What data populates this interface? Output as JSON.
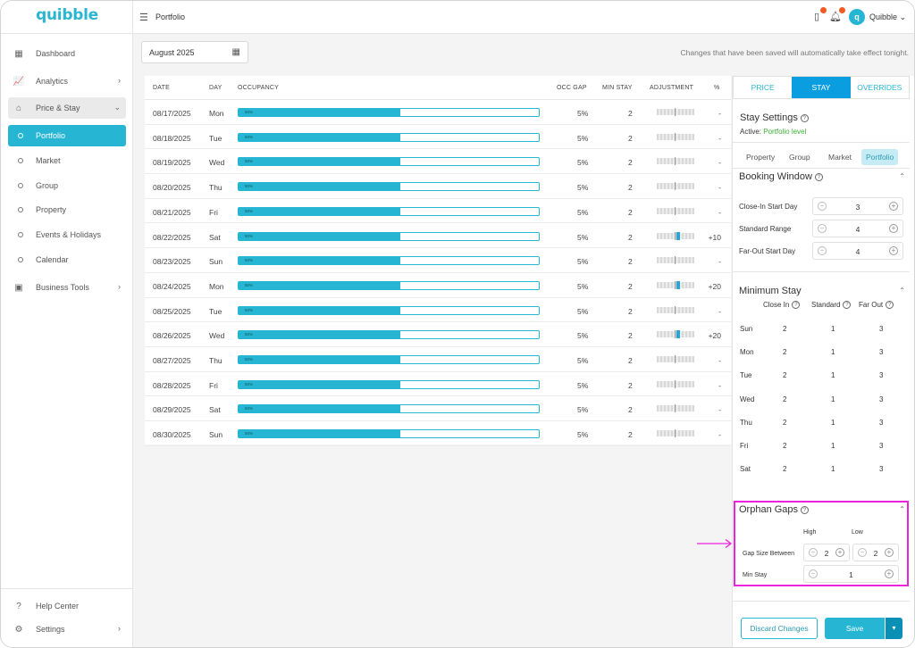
{
  "app": {
    "logo": "quibble"
  },
  "sidebar": {
    "items": [
      {
        "label": "Dashboard",
        "icon": "grid-icon"
      },
      {
        "label": "Analytics",
        "icon": "chart-icon"
      },
      {
        "label": "Price & Stay",
        "icon": "house-dollar-icon"
      },
      {
        "label": "Portfolio"
      },
      {
        "label": "Market"
      },
      {
        "label": "Group"
      },
      {
        "label": "Property"
      },
      {
        "label": "Events & Holidays"
      },
      {
        "label": "Calendar"
      },
      {
        "label": "Business Tools",
        "icon": "briefcase-icon"
      }
    ],
    "help_center": "Help Center",
    "settings": "Settings"
  },
  "topbar": {
    "breadcrumb": "Portfolio",
    "user_name": "Quibble",
    "avatar_letter": "q"
  },
  "toolbar": {
    "month": "August 2025",
    "notice": "Changes that have been saved will automatically take effect tonight."
  },
  "table": {
    "headers": {
      "date": "DATE",
      "day": "DAY",
      "occupancy": "OCCUPANCY",
      "occ_gap": "OCC GAP",
      "min_stay": "MIN STAY",
      "adjustment": "ADJUSTMENT",
      "pct": "%"
    },
    "rows": [
      {
        "date": "08/17/2025",
        "day": "Mon",
        "occ": 0.54,
        "occ_label": "50%",
        "gap": "5%",
        "min": "2",
        "adj": 0,
        "pct": "-"
      },
      {
        "date": "08/18/2025",
        "day": "Tue",
        "occ": 0.54,
        "occ_label": "50%",
        "gap": "5%",
        "min": "2",
        "adj": 0,
        "pct": "-"
      },
      {
        "date": "08/19/2025",
        "day": "Wed",
        "occ": 0.54,
        "occ_label": "50%",
        "gap": "5%",
        "min": "2",
        "adj": 0,
        "pct": "-"
      },
      {
        "date": "08/20/2025",
        "day": "Thu",
        "occ": 0.54,
        "occ_label": "50%",
        "gap": "5%",
        "min": "2",
        "adj": 0,
        "pct": "-"
      },
      {
        "date": "08/21/2025",
        "day": "Fri",
        "occ": 0.54,
        "occ_label": "50%",
        "gap": "5%",
        "min": "2",
        "adj": 0,
        "pct": "-"
      },
      {
        "date": "08/22/2025",
        "day": "Sat",
        "occ": 0.54,
        "occ_label": "50%",
        "gap": "5%",
        "min": "2",
        "adj": 10,
        "pct": "+10"
      },
      {
        "date": "08/23/2025",
        "day": "Sun",
        "occ": 0.54,
        "occ_label": "50%",
        "gap": "5%",
        "min": "2",
        "adj": 0,
        "pct": "-"
      },
      {
        "date": "08/24/2025",
        "day": "Mon",
        "occ": 0.54,
        "occ_label": "50%",
        "gap": "5%",
        "min": "2",
        "adj": 20,
        "pct": "+20"
      },
      {
        "date": "08/25/2025",
        "day": "Tue",
        "occ": 0.54,
        "occ_label": "50%",
        "gap": "5%",
        "min": "2",
        "adj": 0,
        "pct": "-"
      },
      {
        "date": "08/26/2025",
        "day": "Wed",
        "occ": 0.54,
        "occ_label": "50%",
        "gap": "5%",
        "min": "2",
        "adj": 20,
        "pct": "+20"
      },
      {
        "date": "08/27/2025",
        "day": "Thu",
        "occ": 0.54,
        "occ_label": "50%",
        "gap": "5%",
        "min": "2",
        "adj": 0,
        "pct": "-"
      },
      {
        "date": "08/28/2025",
        "day": "Fri",
        "occ": 0.54,
        "occ_label": "50%",
        "gap": "5%",
        "min": "2",
        "adj": 0,
        "pct": "-"
      },
      {
        "date": "08/29/2025",
        "day": "Sat",
        "occ": 0.54,
        "occ_label": "50%",
        "gap": "5%",
        "min": "2",
        "adj": 0,
        "pct": "-"
      },
      {
        "date": "08/30/2025",
        "day": "Sun",
        "occ": 0.54,
        "occ_label": "50%",
        "gap": "5%",
        "min": "2",
        "adj": 0,
        "pct": "-"
      }
    ]
  },
  "panel": {
    "tabs": [
      "PRICE",
      "STAY",
      "OVERRIDES"
    ],
    "title": "Stay Settings",
    "active_label": "Active:",
    "active_value": "Portfolio level",
    "levels": [
      "Property",
      "Group",
      "Market",
      "Portfolio"
    ],
    "booking_window": {
      "title": "Booking Window",
      "rows": [
        {
          "label": "Close-In Start Day",
          "value": "3"
        },
        {
          "label": "Standard Range",
          "value": "4"
        },
        {
          "label": "Far-Out Start Day",
          "value": "4"
        }
      ]
    },
    "minimum_stay": {
      "title": "Minimum Stay",
      "headers": [
        "Close In",
        "Standard",
        "Far Out"
      ],
      "rows": [
        {
          "day": "Sun",
          "close_in": "2",
          "standard": "1",
          "far_out": "3"
        },
        {
          "day": "Mon",
          "close_in": "2",
          "standard": "1",
          "far_out": "3"
        },
        {
          "day": "Tue",
          "close_in": "2",
          "standard": "1",
          "far_out": "3"
        },
        {
          "day": "Wed",
          "close_in": "2",
          "standard": "1",
          "far_out": "3"
        },
        {
          "day": "Thu",
          "close_in": "2",
          "standard": "1",
          "far_out": "3"
        },
        {
          "day": "Fri",
          "close_in": "2",
          "standard": "1",
          "far_out": "3"
        },
        {
          "day": "Sat",
          "close_in": "2",
          "standard": "1",
          "far_out": "3"
        }
      ]
    },
    "orphan_gaps": {
      "title": "Orphan Gaps",
      "high_label": "High",
      "low_label": "Low",
      "gap_label": "Gap Size Between",
      "gap_high": "2",
      "gap_low": "2",
      "min_stay_label": "Min Stay",
      "min_stay_value": "1"
    },
    "discard_label": "Discard Changes",
    "save_label": "Save"
  },
  "colors": {
    "accent": "#26b6d3",
    "highlight": "#ee22dd",
    "active_green": "#3db037"
  }
}
